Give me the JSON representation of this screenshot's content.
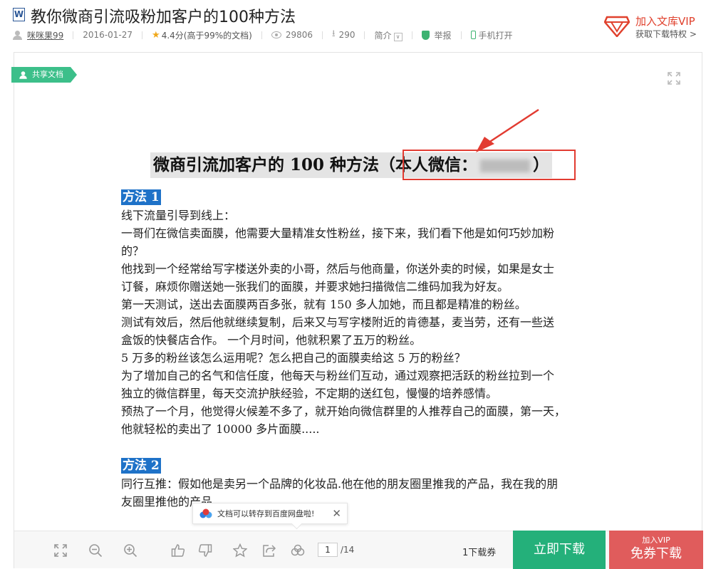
{
  "header": {
    "word_icon": "W",
    "title": "教你微商引流吸粉加客户的100种方法",
    "author": "咪咪果99",
    "date": "2016-01-27",
    "rating": "4.4分",
    "rating_note": "(高于99%的文档)",
    "views": "29806",
    "downloads": "290",
    "intro_label": "简介",
    "report_label": "举报",
    "mobile_label": "手机打开"
  },
  "vip": {
    "title": "加入文库VIP",
    "subtitle": "获取下载特权 >"
  },
  "viewer": {
    "share_tag": "共享文档"
  },
  "document": {
    "heading_main": "微商引流加客户的 100 种方法",
    "heading_wechat_label": "（本人微信：",
    "heading_close": "）",
    "method1_label": "方法 1",
    "lines1": [
      "线下流量引导到线上：",
      "一哥们在微信卖面膜，他需要大量精准女性粉丝，接下来，我们看下他是如何巧妙加粉",
      "的？",
      "他找到一个经常给写字楼送外卖的小哥，然后与他商量，你送外卖的时候，如果是女士",
      "订餐，麻烦你赠送她一张我们的面膜，并要求她扫描微信二维码加我为好友。",
      "第一天测试，送出去面膜两百多张，就有 150 多人加她，而且都是精准的粉丝。",
      "测试有效后，然后他就继续复制，后来又与写字楼附近的肯德基，麦当劳，还有一些送",
      "盒饭的快餐店合作。 一个月时间，他就积累了五万的粉丝。",
      "5 万多的粉丝该怎么运用呢？怎么把自己的面膜卖给这 5 万的粉丝？",
      "为了增加自己的名气和信任度，他每天与粉丝们互动，通过观察把活跃的粉丝拉到一个",
      "独立的微信群里，每天交流护肤经验，不定期的送红包，慢慢的培养感情。",
      "预热了一个月，他觉得火候差不多了，就开始向微信群里的人推荐自己的面膜，第一天，",
      "他就轻松的卖出了 10000 多片面膜....."
    ],
    "method2_label": "方法 2",
    "lines2": [
      "同行互推：假如他是卖另一个品牌的化妆品.他在他的朋友圈里推我的产品，我在我的朋",
      "友圈里推他的产品"
    ]
  },
  "toast": {
    "message": "文档可以转存到百度网盘啦!",
    "close": "✕"
  },
  "toolbar": {
    "page_current": "1",
    "page_total": "/14",
    "coupon": "1下载券",
    "download_now": "立即下载",
    "vip_line1": "加入VIP",
    "vip_line2": "免券下载"
  },
  "colors": {
    "green": "#24b07a",
    "red": "#e05c5c",
    "method_blue": "#1e72c8",
    "highlight_red": "#e23b31"
  }
}
